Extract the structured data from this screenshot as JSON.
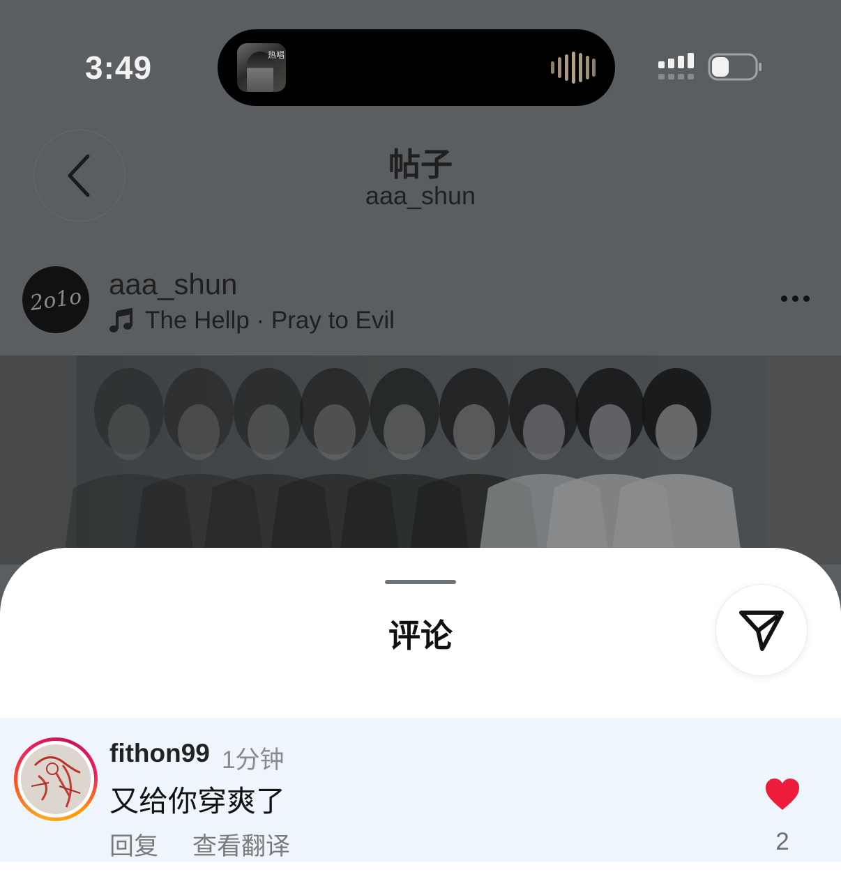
{
  "status_bar": {
    "time": "3:49",
    "now_playing_art_text": "热唱",
    "icons": [
      "waveform-icon",
      "signal-icon",
      "battery-icon"
    ]
  },
  "header": {
    "title": "帖子",
    "subtitle": "aaa_shun",
    "back_icon": "chevron-left-icon"
  },
  "post": {
    "author": "aaa_shun",
    "avatar_text": "2o1o",
    "music_artist": "The Hellp",
    "separator": " · ",
    "music_title": "Pray to Evil",
    "more_icon": "more-icon"
  },
  "comments_sheet": {
    "title": "评论",
    "share_icon": "send-icon",
    "comments": [
      {
        "user": "fithon99",
        "time": "1分钟",
        "text": "又给你穿爽了",
        "reply_label": "回复",
        "translate_label": "查看翻译",
        "likes": "2",
        "liked": true
      }
    ]
  },
  "colors": {
    "overlay": "#5a5e61",
    "highlight_row": "#eff5fd",
    "like_red": "#ee1c3b",
    "sheet": "#ffffff"
  }
}
